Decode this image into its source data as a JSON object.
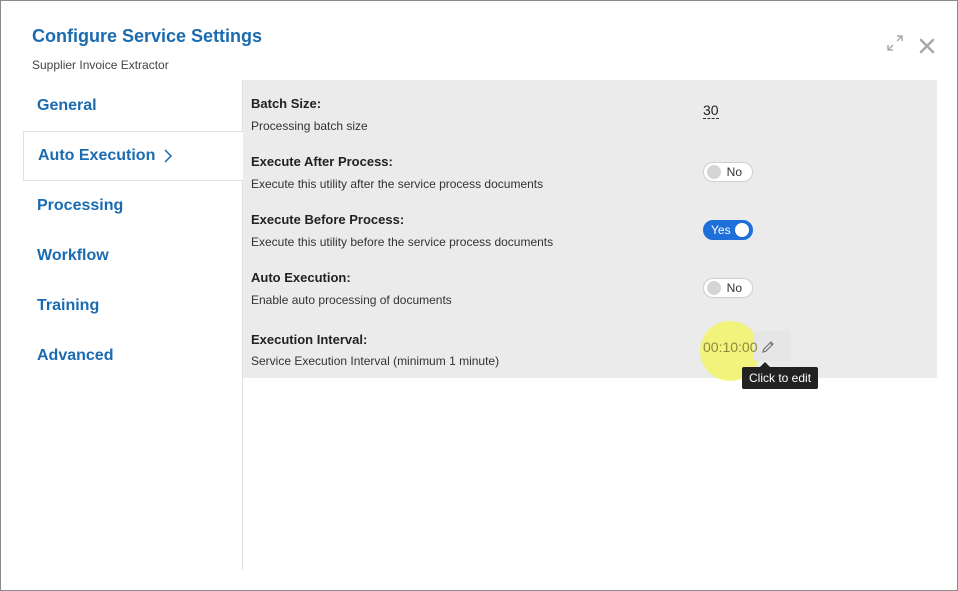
{
  "dialog": {
    "title": "Configure Service Settings",
    "subtitle": "Supplier Invoice Extractor"
  },
  "sidebar": {
    "items": [
      {
        "label": "General",
        "active": false
      },
      {
        "label": "Auto Execution",
        "active": true
      },
      {
        "label": "Processing",
        "active": false
      },
      {
        "label": "Workflow",
        "active": false
      },
      {
        "label": "Training",
        "active": false
      },
      {
        "label": "Advanced",
        "active": false
      }
    ]
  },
  "settings": {
    "batch_size": {
      "label": "Batch Size:",
      "desc": "Processing batch size",
      "value": "30"
    },
    "execute_after": {
      "label": "Execute After Process:",
      "desc": "Execute this utility after the service process documents",
      "value": "No"
    },
    "execute_before": {
      "label": "Execute Before Process:",
      "desc": "Execute this utility before the service process documents",
      "value": "Yes"
    },
    "auto_execution": {
      "label": "Auto Execution:",
      "desc": "Enable auto processing of documents",
      "value": "No"
    },
    "interval": {
      "label": "Execution Interval:",
      "desc": "Service Execution Interval (minimum 1 minute)",
      "value": "00:10:00"
    }
  },
  "tooltip": {
    "text": "Click to edit"
  },
  "colors": {
    "accent": "#1a6bb0",
    "toggle_on": "#1e6fd9",
    "panel_bg": "#ebebeb",
    "highlight": "#f3f56a"
  },
  "icons": {
    "expand": "expand-icon",
    "close": "close-icon",
    "chevron": "chevron-right-icon",
    "edit": "pencil-icon"
  }
}
